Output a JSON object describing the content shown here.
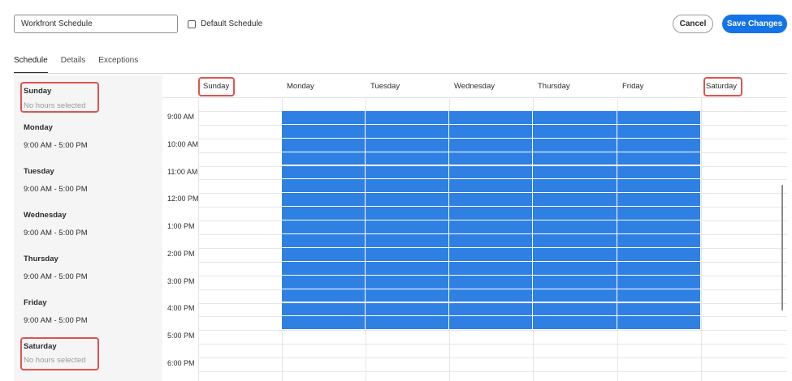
{
  "header": {
    "name_value": "Workfront Schedule",
    "default_label": "Default Schedule",
    "default_checked": false,
    "cancel_label": "Cancel",
    "save_label": "Save Changes"
  },
  "tabs": [
    {
      "label": "Schedule",
      "active": true
    },
    {
      "label": "Details",
      "active": false
    },
    {
      "label": "Exceptions",
      "active": false
    }
  ],
  "sidebar": {
    "days": [
      {
        "day": "Sunday",
        "hours": "No hours selected",
        "working": false
      },
      {
        "day": "Monday",
        "hours": "9:00 AM - 5:00 PM",
        "working": true
      },
      {
        "day": "Tuesday",
        "hours": "9:00 AM - 5:00 PM",
        "working": true
      },
      {
        "day": "Wednesday",
        "hours": "9:00 AM - 5:00 PM",
        "working": true
      },
      {
        "day": "Thursday",
        "hours": "9:00 AM - 5:00 PM",
        "working": true
      },
      {
        "day": "Friday",
        "hours": "9:00 AM - 5:00 PM",
        "working": true
      },
      {
        "day": "Saturday",
        "hours": "No hours selected",
        "working": false
      }
    ]
  },
  "grid": {
    "columns": [
      "Sunday",
      "Monday",
      "Tuesday",
      "Wednesday",
      "Thursday",
      "Friday",
      "Saturday"
    ],
    "time_labels": [
      "9:00 AM",
      "10:00 AM",
      "11:00 AM",
      "12:00 PM",
      "1:00 PM",
      "2:00 PM",
      "3:00 PM",
      "4:00 PM",
      "5:00 PM",
      "6:00 PM"
    ],
    "selected_days": [
      1,
      2,
      3,
      4,
      5
    ],
    "selected_start": "9:00 AM",
    "selected_end": "5:00 PM"
  },
  "colors": {
    "accent": "#1473e6",
    "selected_cell": "#2f80e3",
    "highlight": "#e0534f"
  }
}
